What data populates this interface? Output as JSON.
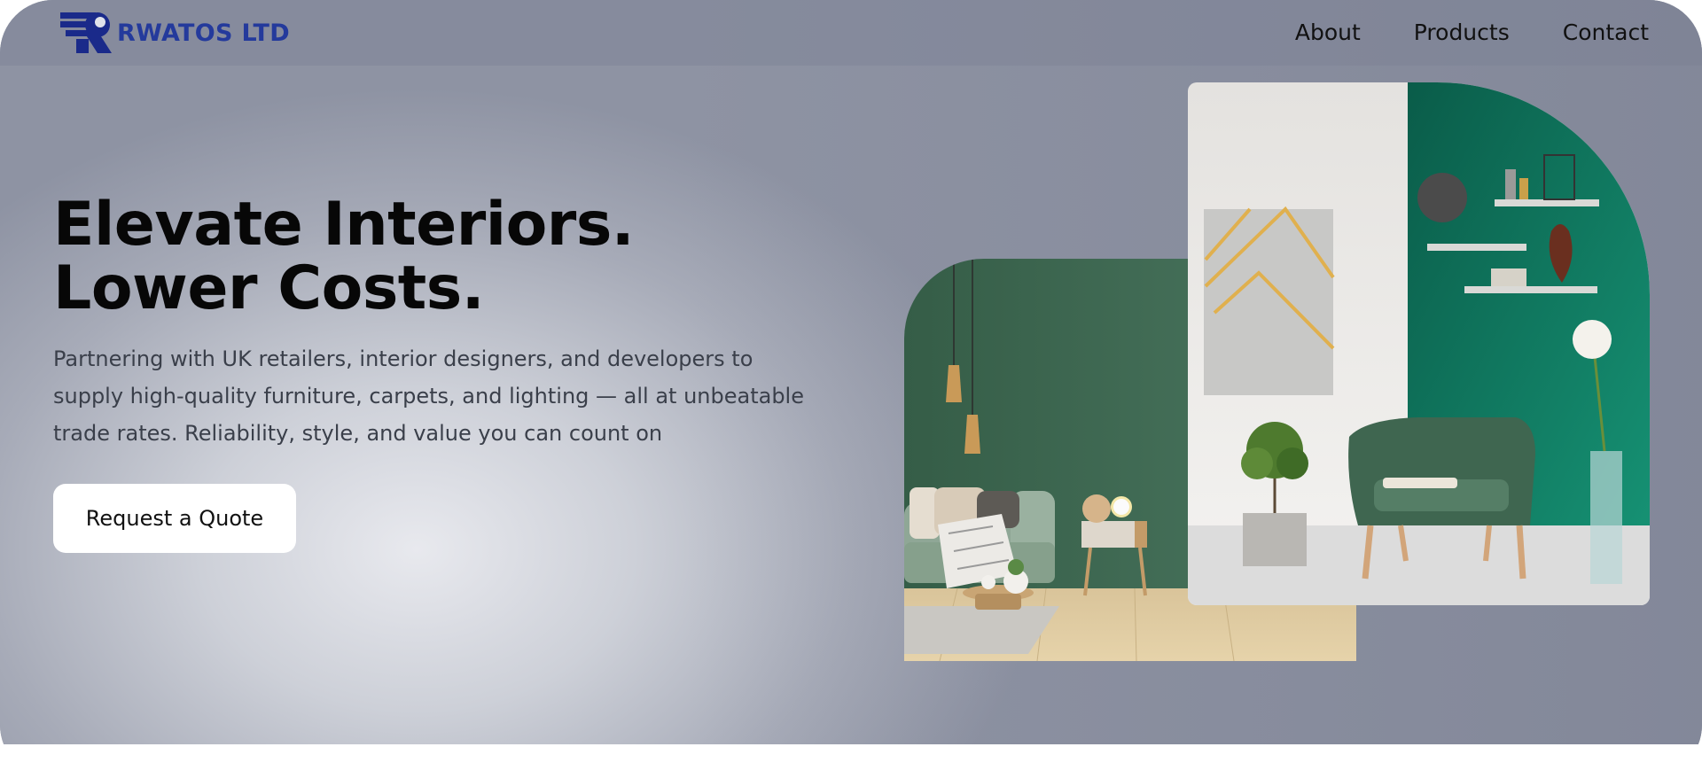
{
  "brand": {
    "name": "RWATOS LTD",
    "logo_icon": "rwatos-logo-icon",
    "color": "#243a9c"
  },
  "nav": {
    "items": [
      {
        "label": "About"
      },
      {
        "label": "Products"
      },
      {
        "label": "Contact"
      }
    ]
  },
  "hero": {
    "headline": "Elevate Interiors. Lower Costs.",
    "subtext": "Partnering with UK retailers, interior designers, and developers to supply high-quality furniture, carpets, and lighting — all at unbeatable trade rates. Reliability, style, and value you can count on",
    "cta_label": "Request a Quote"
  },
  "images": {
    "back": "living-room-green-wall-sofa-image",
    "front": "green-armchair-teal-wall-shelves-image"
  },
  "colors": {
    "accent": "#243a9c",
    "hero_bg": "#a7abb8",
    "green_wall": "#3f6a52",
    "teal_wall": "#0d6b55"
  }
}
